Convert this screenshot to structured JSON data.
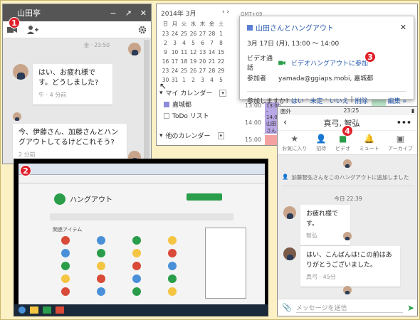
{
  "panel1": {
    "badge": "1",
    "title": "山田亭",
    "window_controls": [
      "−",
      "↗",
      "✕"
    ],
    "toolbar_icons": [
      "video-icon",
      "add-person-icon",
      "gear-icon"
    ],
    "top_time": "金 · 23:50",
    "messages": [
      {
        "text": "はい、お疲れ様です。どうしました?",
        "meta": "午 · 4 分前"
      },
      {
        "text": "今、伊藤さん、加藤さんとハングアウトしてるけどこれそう?",
        "meta": "2 分前"
      }
    ]
  },
  "panel3": {
    "badge": "3",
    "month": "2014年 3月",
    "weekdays": [
      "日",
      "月",
      "火",
      "水",
      "木",
      "金",
      "土"
    ],
    "days": [
      "23",
      "24",
      "25",
      "26",
      "27",
      "28",
      "1",
      "2",
      "3",
      "4",
      "5",
      "6",
      "7",
      "8",
      "9",
      "10",
      "11",
      "12",
      "13",
      "14",
      "15",
      "16",
      "17",
      "18",
      "19",
      "20",
      "21",
      "22",
      "23",
      "24",
      "25",
      "26",
      "27",
      "28",
      "29",
      "30",
      "31",
      "1",
      "2",
      "3",
      "4",
      "5"
    ],
    "highlight_day": "15",
    "my_calendars_label": "マイ カレンダー",
    "calendar_items": [
      "嘉城都",
      "ToDo リスト"
    ],
    "other_calendars_label": "他のカレンダー",
    "gmt_label": "GMT+09",
    "times": [
      "13:00",
      "14:00",
      "15:00"
    ],
    "event_label": "13:00 - 14:00",
    "event_sub": "山田さんとハングアウト",
    "popup": {
      "title": "山田さんとハングアウト",
      "datetime": "3月 17日 (月), 13:00 ～ 14:00",
      "video_label": "ビデオ通話",
      "video_link": "ビデオハングアウトに参加",
      "attendees_label": "参加者",
      "attendees_value": "yamada@ggiaps.mobi, 嘉城都",
      "rsvp_label": "参加しますか?",
      "rsvp_yes": "はい",
      "rsvp_maybe": "未定",
      "rsvp_no": "いいえ",
      "delete": "削除",
      "edit": "編集 »"
    }
  },
  "panel2": {
    "badge": "2",
    "app_title": "ハングアウト",
    "section_label": "関連アイテム"
  },
  "panel4": {
    "badge": "4",
    "carrier": "圏外",
    "time": "23:25",
    "title": "真弓, 智弘",
    "actions": [
      "お気に入り",
      "招待",
      "ビデオ",
      "ミュート",
      "アーカイブ"
    ],
    "system_msg": "加藤智弘さんをこのハングアウトに追加しました",
    "date_divider": "今日 22:39",
    "messages": [
      {
        "text": "お疲れ様です。",
        "meta": "智弘"
      },
      {
        "text": "はい、こんばんは!この前はありがとうございました。",
        "meta": "真弓 · 45分"
      }
    ],
    "input_placeholder": "メッセージを送信"
  },
  "colors": {
    "badge": "#e0202a",
    "accent_green": "#2a9d4a",
    "link_blue": "#2255aa",
    "event_purple": "#b9a7e6",
    "event_red": "#f4a2a0"
  }
}
